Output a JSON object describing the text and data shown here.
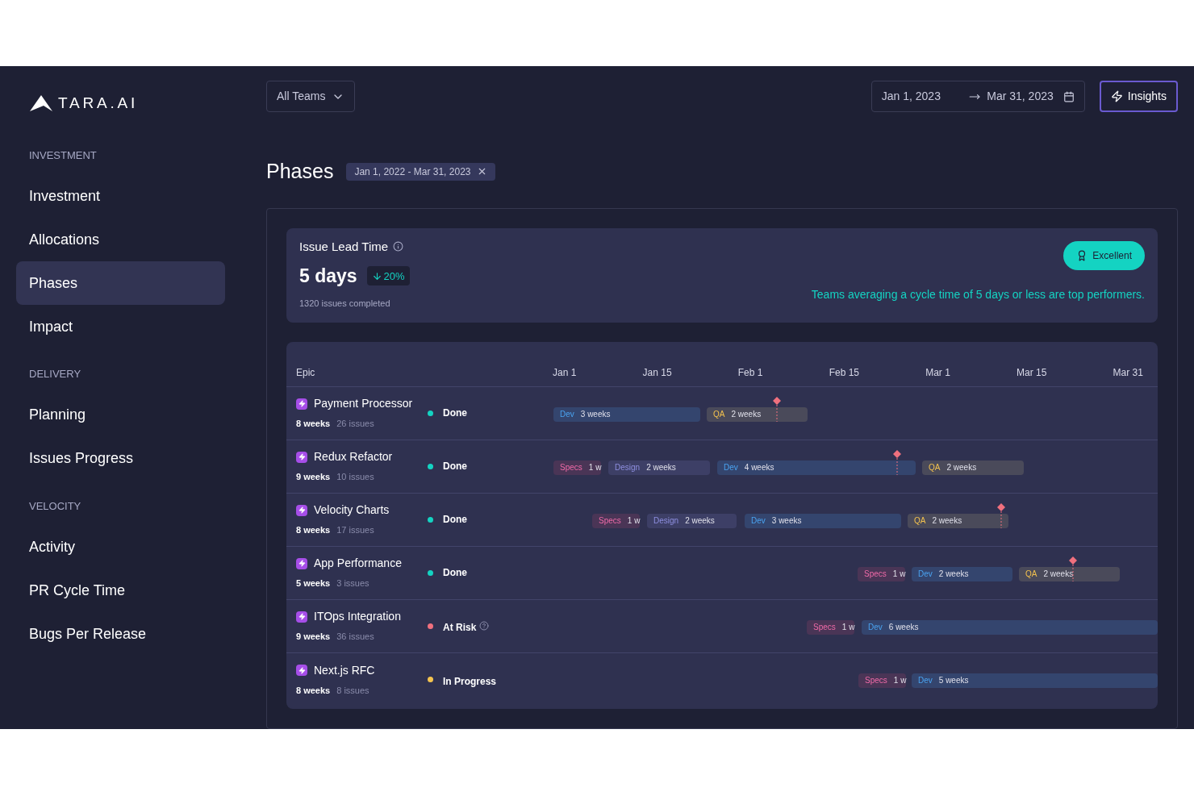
{
  "logo": {
    "text": "TARA.AI"
  },
  "sidebar": {
    "sections": [
      {
        "heading": "INVESTMENT",
        "items": [
          {
            "label": "Investment",
            "selected": false
          },
          {
            "label": "Allocations",
            "selected": false
          },
          {
            "label": "Phases",
            "selected": true
          },
          {
            "label": "Impact",
            "selected": false
          }
        ]
      },
      {
        "heading": "DELIVERY",
        "items": [
          {
            "label": "Planning",
            "selected": false
          },
          {
            "label": "Issues Progress",
            "selected": false
          }
        ]
      },
      {
        "heading": "VELOCITY",
        "items": [
          {
            "label": "Activity",
            "selected": false
          },
          {
            "label": "PR Cycle Time",
            "selected": false
          },
          {
            "label": "Bugs Per Release",
            "selected": false
          }
        ]
      }
    ]
  },
  "toolbar": {
    "team_select": "All Teams",
    "date_start": "Jan 1, 2023",
    "date_end": "Mar 31, 2023",
    "insights_button": "Insights"
  },
  "page": {
    "title": "Phases",
    "filter_chip": "Jan 1, 2022 - Mar 31, 2023"
  },
  "lead_time": {
    "title": "Issue Lead Time",
    "value": "5 days",
    "change": "20%",
    "subtitle": "1320 issues completed",
    "badge": "Excellent",
    "note": "Teams averaging a cycle time of 5 days or less are top performers."
  },
  "gantt": {
    "epic_header": "Epic",
    "dates": [
      "Jan 1",
      "Jan 15",
      "Feb 1",
      "Feb 15",
      "Mar 1",
      "Mar 15",
      "Mar 31"
    ],
    "rows": [
      {
        "name": "Payment Processor",
        "duration": "8 weeks",
        "issues": "26 issues",
        "status": {
          "label": "Done",
          "kind": "done",
          "color": "#14d3c2"
        },
        "milestone": true,
        "bars": [
          {
            "kind": "dev",
            "label": "Dev",
            "length": "3 weeks"
          },
          {
            "kind": "qa",
            "label": "QA",
            "length": "2 weeks"
          }
        ]
      },
      {
        "name": "Redux Refactor",
        "duration": "9 weeks",
        "issues": "10 issues",
        "status": {
          "label": "Done",
          "kind": "done",
          "color": "#14d3c2"
        },
        "milestone": true,
        "bars": [
          {
            "kind": "specs",
            "label": "Specs",
            "length": "1 w"
          },
          {
            "kind": "design",
            "label": "Design",
            "length": "2 weeks"
          },
          {
            "kind": "dev",
            "label": "Dev",
            "length": "4 weeks"
          },
          {
            "kind": "qa",
            "label": "QA",
            "length": "2 weeks"
          }
        ]
      },
      {
        "name": "Velocity Charts",
        "duration": "8 weeks",
        "issues": "17 issues",
        "status": {
          "label": "Done",
          "kind": "done",
          "color": "#14d3c2"
        },
        "milestone": true,
        "bars": [
          {
            "kind": "specs",
            "label": "Specs",
            "length": "1 w"
          },
          {
            "kind": "design",
            "label": "Design",
            "length": "2 weeks"
          },
          {
            "kind": "dev",
            "label": "Dev",
            "length": "3 weeks"
          },
          {
            "kind": "qa",
            "label": "QA",
            "length": "2 weeks"
          }
        ]
      },
      {
        "name": "App Performance",
        "duration": "5 weeks",
        "issues": "3 issues",
        "status": {
          "label": "Done",
          "kind": "done",
          "color": "#14d3c2"
        },
        "milestone": true,
        "bars": [
          {
            "kind": "specs",
            "label": "Specs",
            "length": "1 w"
          },
          {
            "kind": "dev",
            "label": "Dev",
            "length": "2 weeks"
          },
          {
            "kind": "qa",
            "label": "QA",
            "length": "2 weeks"
          }
        ]
      },
      {
        "name": "ITOps Integration",
        "duration": "9 weeks",
        "issues": "36 issues",
        "status": {
          "label": "At Risk",
          "kind": "at_risk",
          "color": "#f0707e",
          "help": true
        },
        "milestone": false,
        "bars": [
          {
            "kind": "specs",
            "label": "Specs",
            "length": "1 w"
          },
          {
            "kind": "dev",
            "label": "Dev",
            "length": "6 weeks"
          }
        ]
      },
      {
        "name": "Next.js RFC",
        "duration": "8 weeks",
        "issues": "8 issues",
        "status": {
          "label": "In Progress",
          "kind": "in_progress",
          "color": "#f5c44f"
        },
        "milestone": false,
        "bars": [
          {
            "kind": "specs",
            "label": "Specs",
            "length": "1 w"
          },
          {
            "kind": "dev",
            "label": "Dev",
            "length": "5 weeks"
          }
        ]
      }
    ]
  }
}
